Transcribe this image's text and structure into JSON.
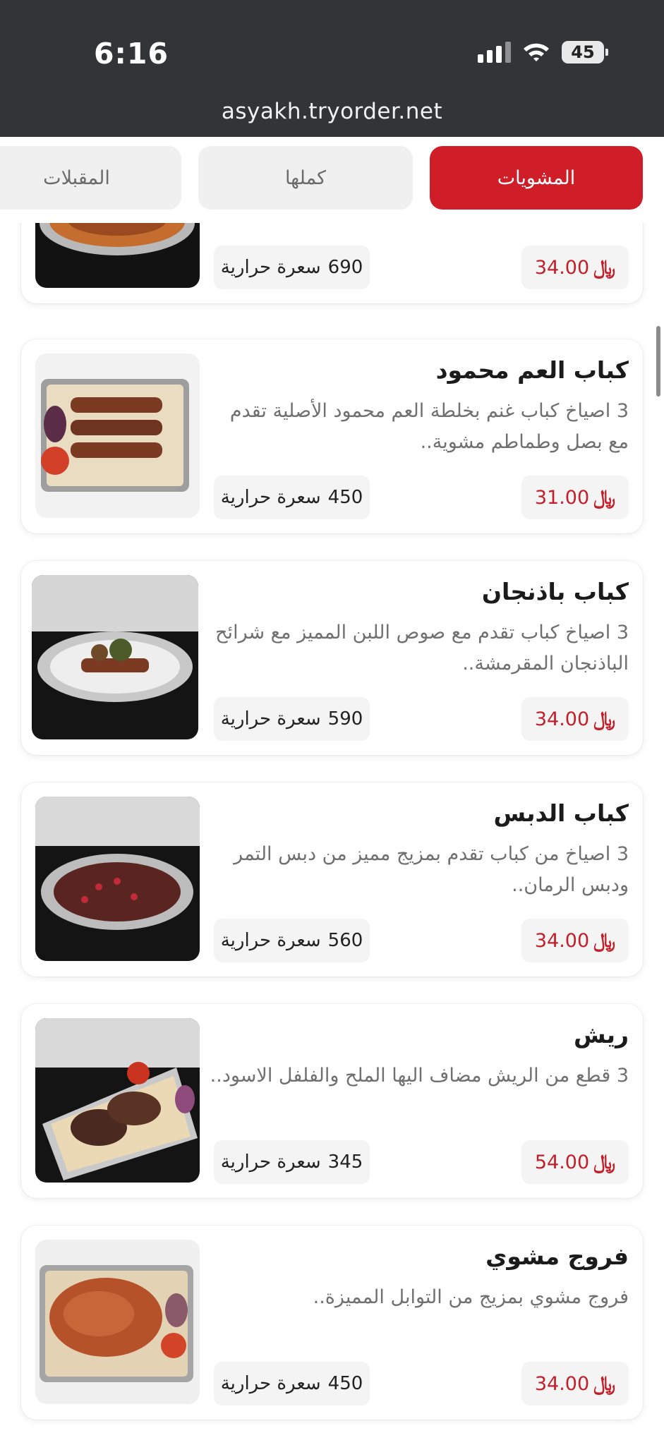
{
  "status": {
    "time": "6:16",
    "battery": "45"
  },
  "browser": {
    "url": "asyakh.tryorder.net"
  },
  "tabs": [
    {
      "label": "المشويات",
      "active": true
    },
    {
      "label": "كملها",
      "active": false
    },
    {
      "label": "المقبلات",
      "active": false
    }
  ],
  "currency_symbol": "﷼",
  "calories_label": "سعرة حرارية",
  "items": [
    {
      "title": "",
      "description": "",
      "price": "34.00",
      "calories": "690",
      "image": "kebab-tray-image"
    },
    {
      "title": "كباب العم محمود",
      "description": "3 اصياخ كباب غنم بخلطة العم محمود الأصلية تقدم مع بصل وطماطم مشوية..",
      "price": "31.00",
      "calories": "450",
      "image": "kebab-tray-image"
    },
    {
      "title": "كباب باذنجان",
      "description": "3 اصياخ كباب تقدم مع صوص اللبن المميز مع شرائح الباذنجان المقرمشة..",
      "price": "34.00",
      "calories": "590",
      "image": "eggplant-kebab-image"
    },
    {
      "title": "كباب الدبس",
      "description": "3 اصياخ من كباب تقدم بمزيج مميز من دبس التمر ودبس الرمان..",
      "price": "34.00",
      "calories": "560",
      "image": "dibs-kebab-image"
    },
    {
      "title": "ريش",
      "description": "3 قطع من الريش مضاف اليها الملح والفلفل الاسود..",
      "price": "54.00",
      "calories": "345",
      "image": "lamb-chops-image"
    },
    {
      "title": "فروج مشوي",
      "description": "فروج مشوي بمزيج من التوابل المميزة..",
      "price": "34.00",
      "calories": "450",
      "image": "grilled-chicken-image"
    }
  ]
}
